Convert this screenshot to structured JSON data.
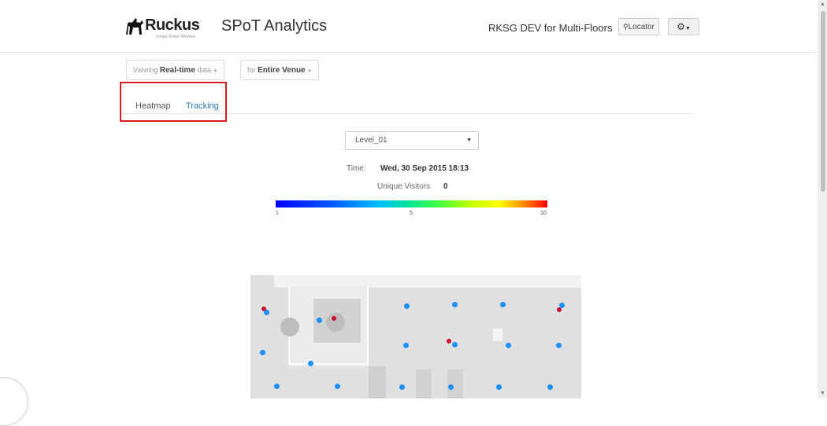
{
  "header": {
    "logo_text": "Ruckus",
    "logo_tagline": "Simply Better Wireless",
    "app_name": "SPoT Analytics",
    "venue": "RKSG DEV for Multi-Floors",
    "locator_label": "Locator",
    "settings_icon": "gear-icon"
  },
  "filters": {
    "viewing_prefix": "Viewing",
    "viewing_value": "Real-time",
    "viewing_suffix": "data",
    "scope_prefix": "for",
    "scope_value": "Entire Venue"
  },
  "tabs": [
    {
      "label": "Heatmap"
    },
    {
      "label": "Tracking"
    }
  ],
  "main": {
    "level": "Level_01",
    "time_label": "Time:",
    "time_value": "Wed, 30 Sep 2015 18:13",
    "visitors_label": "Unique Visitors",
    "visitors_value": "0",
    "scale_min": "1",
    "scale_mid": "5",
    "scale_max": "10"
  },
  "colors": {
    "highlight": "#d71920",
    "ap_blue": "#1e90ff",
    "ap_red": "#c8102e",
    "link": "#2a7ab8"
  }
}
